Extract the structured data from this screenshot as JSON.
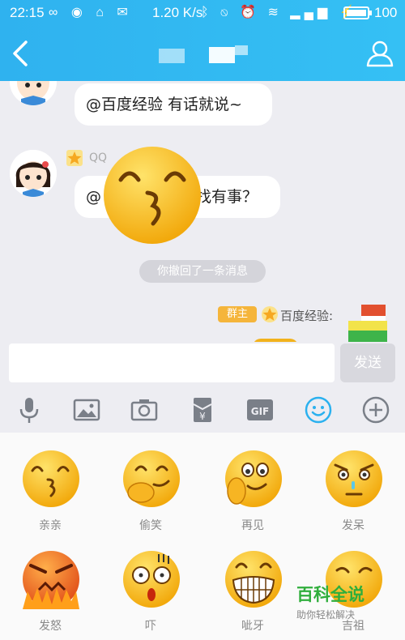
{
  "status_bar": {
    "time": "22:15",
    "speed": "1.20 K/s",
    "battery": "100",
    "battery_level": 1.0,
    "icons": [
      "infinity-icon",
      "circle-icon",
      "home-icon",
      "mail-icon",
      "bluetooth-icon",
      "mute-icon",
      "alarm-icon",
      "wifi-icon",
      "signal-icon",
      "charging-icon"
    ]
  },
  "title_bar": {
    "back_icon": "back-arrow-icon",
    "profile_icon": "group-members-icon"
  },
  "chat": {
    "message1": "@百度经验 有话就说~",
    "message2_sender": "QQ",
    "message2_prefix": "@",
    "message2_suffix": "找有事？",
    "recall_notice": "你撤回了一条消息",
    "admin_tag": "群主",
    "admin_sender": "百度经验:"
  },
  "input": {
    "value": "",
    "send_label": "发送"
  },
  "toolbar": {
    "items": [
      "microphone-icon",
      "image-icon",
      "camera-icon",
      "red-packet-icon",
      "gif-icon",
      "emoji-icon",
      "plus-icon"
    ],
    "gif_label": "GIF",
    "redpacket_label": "¥"
  },
  "emoji_panel": {
    "items": [
      {
        "label": "亲亲"
      },
      {
        "label": "偷笑"
      },
      {
        "label": "再见"
      },
      {
        "label": "发呆"
      },
      {
        "label": "发怒"
      },
      {
        "label": "吓"
      },
      {
        "label": "呲牙"
      },
      {
        "label": "吉祖"
      }
    ]
  },
  "watermark": {
    "title": "百科全说",
    "subtitle": "助你轻松解决"
  },
  "colors": {
    "header": "#33b8f2",
    "accent": "#2fae3c",
    "emoji_yellow": "#f9c21c"
  }
}
